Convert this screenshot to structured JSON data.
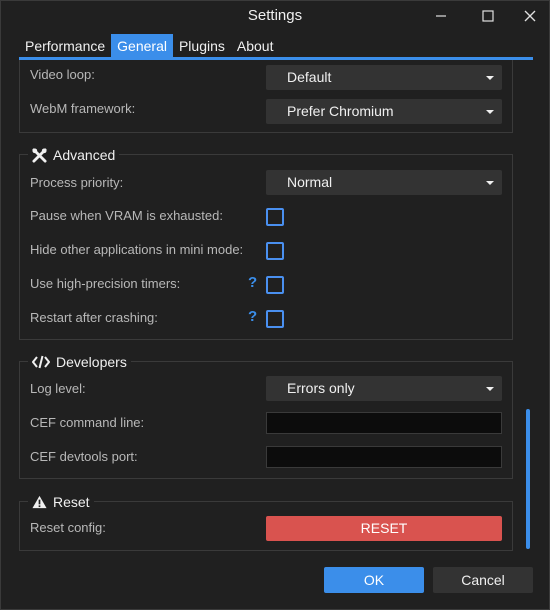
{
  "window": {
    "title": "Settings"
  },
  "tabs": [
    {
      "label": "Performance",
      "active": false
    },
    {
      "label": "General",
      "active": true
    },
    {
      "label": "Plugins",
      "active": false
    },
    {
      "label": "About",
      "active": false
    }
  ],
  "playback": {
    "video_loop": {
      "label": "Video loop:",
      "value": "Default"
    },
    "webm_framework": {
      "label": "WebM framework:",
      "value": "Prefer Chromium"
    }
  },
  "advanced": {
    "title": "Advanced",
    "icon": "tools-icon",
    "process_priority": {
      "label": "Process priority:",
      "value": "Normal"
    },
    "pause_vram": {
      "label": "Pause when VRAM is exhausted:",
      "checked": false
    },
    "hide_apps": {
      "label": "Hide other applications in mini mode:",
      "checked": false
    },
    "high_precision": {
      "label": "Use high-precision timers:",
      "checked": false,
      "help": "?"
    },
    "restart_crash": {
      "label": "Restart after crashing:",
      "checked": false,
      "help": "?"
    }
  },
  "developers": {
    "title": "Developers",
    "icon": "code-icon",
    "log_level": {
      "label": "Log level:",
      "value": "Errors only"
    },
    "cef_command_line": {
      "label": "CEF command line:",
      "value": ""
    },
    "cef_devtools_port": {
      "label": "CEF devtools port:",
      "value": ""
    }
  },
  "reset": {
    "title": "Reset",
    "icon": "warning-icon",
    "reset_config": {
      "label": "Reset config:",
      "button": "RESET"
    }
  },
  "footer": {
    "ok_label": "OK",
    "cancel_label": "Cancel"
  },
  "colors": {
    "accent": "#3b8eea",
    "danger": "#d9534f",
    "background": "#202020"
  }
}
